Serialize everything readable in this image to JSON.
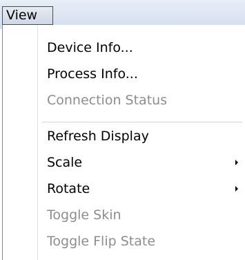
{
  "menubar": {
    "menu_label": "View"
  },
  "menu": {
    "items": [
      {
        "label": "Device Info...",
        "enabled": true
      },
      {
        "label": "Process Info...",
        "enabled": true
      },
      {
        "label": "Connection Status",
        "enabled": false
      },
      {
        "label": "Refresh Display",
        "enabled": true
      },
      {
        "label": "Scale",
        "enabled": true,
        "submenu": true
      },
      {
        "label": "Rotate",
        "enabled": true,
        "submenu": true
      },
      {
        "label": "Toggle Skin",
        "enabled": false
      },
      {
        "label": "Toggle Flip State",
        "enabled": false
      }
    ]
  }
}
